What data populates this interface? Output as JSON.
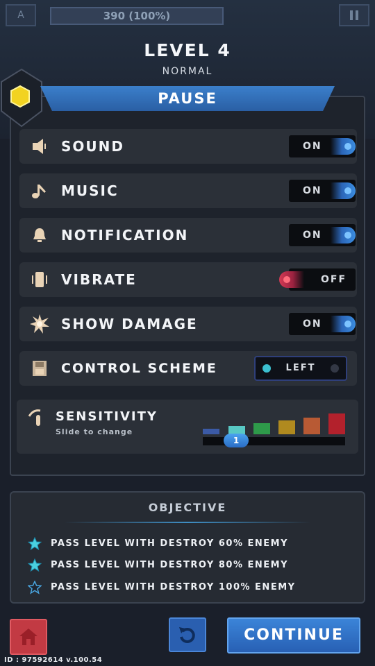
{
  "hud": {
    "hp_text": "390 (100%)",
    "left_button": "A"
  },
  "level": {
    "title": "LEVEL 4",
    "difficulty": "NORMAL"
  },
  "pause": {
    "title": "PAUSE",
    "settings": [
      {
        "label": "SOUND",
        "state": "ON",
        "icon": "speaker-icon"
      },
      {
        "label": "MUSIC",
        "state": "ON",
        "icon": "music-note-icon"
      },
      {
        "label": "NOTIFICATION",
        "state": "ON",
        "icon": "bell-icon"
      },
      {
        "label": "VIBRATE",
        "state": "OFF",
        "icon": "vibrate-phone-icon"
      },
      {
        "label": "SHOW DAMAGE",
        "state": "ON",
        "icon": "explosion-icon"
      }
    ],
    "control_scheme": {
      "label": "CONTROL SCHEME",
      "value": "LEFT",
      "icon": "floppy-icon"
    },
    "sensitivity": {
      "label": "SENSITIVITY",
      "hint": "Slide to change",
      "value": "1",
      "levels": 6,
      "bar_colors": [
        "#3b5aa6",
        "#58c8c4",
        "#2e9a4a",
        "#b08a1f",
        "#b85a34",
        "#b3212c"
      ]
    }
  },
  "objective": {
    "title": "OBJECTIVE",
    "items": [
      {
        "text": "PASS LEVEL WITH DESTROY 60% ENEMY",
        "achieved": true
      },
      {
        "text": "PASS LEVEL WITH DESTROY 80% ENEMY",
        "achieved": true
      },
      {
        "text": "PASS LEVEL WITH DESTROY 100% ENEMY",
        "achieved": false
      }
    ]
  },
  "buttons": {
    "continue": "CONTINUE"
  },
  "build_id": "ID : 97592614  v.100.54",
  "colors": {
    "accent": "#2e6fc4",
    "off": "#c8324a",
    "panel": "#1e232c",
    "row": "#2b3038"
  }
}
